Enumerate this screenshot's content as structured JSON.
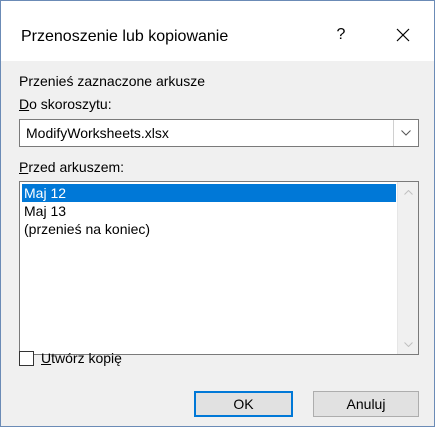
{
  "dialog": {
    "title": "Przenoszenie lub kopiowanie",
    "help_label": "?",
    "close_icon": "close-icon"
  },
  "move_label": "Przenieś zaznaczone arkusze",
  "to_book": {
    "label_accel": "D",
    "label_rest": "o skoroszytu:",
    "value": "ModifyWorksheets.xlsx",
    "arrow_icon": "chevron-down-icon"
  },
  "before_sheet": {
    "label_accel": "P",
    "label_rest": "rzed arkuszem:",
    "items": [
      {
        "label": "Maj 12",
        "selected": true
      },
      {
        "label": "Maj 13",
        "selected": false
      },
      {
        "label": "(przenieś na koniec)",
        "selected": false
      }
    ]
  },
  "create_copy": {
    "label_accel": "U",
    "label_rest": "twórz kopię",
    "checked": false
  },
  "buttons": {
    "ok": "OK",
    "cancel": "Anuluj"
  },
  "colors": {
    "selection": "#0078d7",
    "dialog_bg": "#f0f0f0",
    "border": "#6b8bb6"
  }
}
